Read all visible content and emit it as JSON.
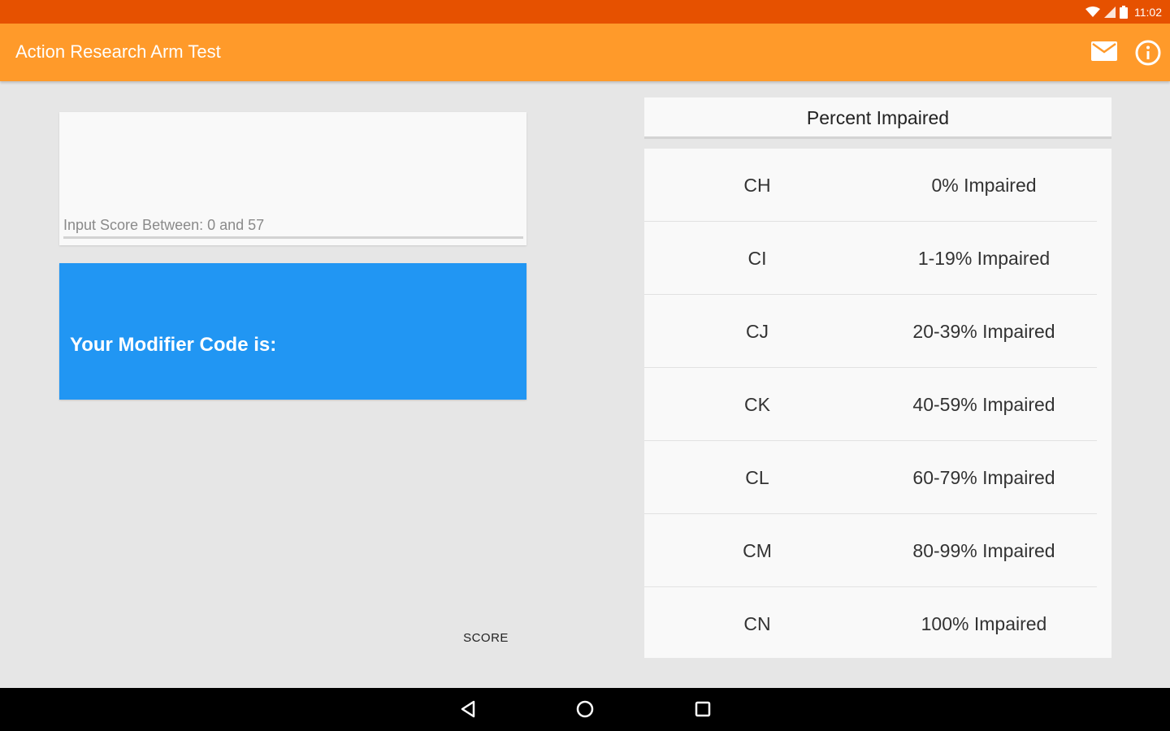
{
  "status_bar": {
    "time": "11:02",
    "icons": [
      "wifi-icon",
      "signal-icon",
      "battery-icon"
    ]
  },
  "app_bar": {
    "title": "Action Research Arm Test",
    "actions": [
      "mail-icon",
      "info-icon"
    ]
  },
  "score_input": {
    "value": "",
    "placeholder": "Input Score Between: 0 and 57"
  },
  "modifier": {
    "label": "Your Modifier Code is:"
  },
  "score_button": {
    "label": "SCORE"
  },
  "table": {
    "header": "Percent Impaired",
    "rows": [
      {
        "code": "CH",
        "percent": "0% Impaired"
      },
      {
        "code": "CI",
        "percent": "1-19% Impaired"
      },
      {
        "code": "CJ",
        "percent": "20-39% Impaired"
      },
      {
        "code": "CK",
        "percent": "40-59% Impaired"
      },
      {
        "code": "CL",
        "percent": "60-79% Impaired"
      },
      {
        "code": "CM",
        "percent": "80-99% Impaired"
      },
      {
        "code": "CN",
        "percent": "100% Impaired"
      }
    ]
  },
  "nav_bar": {
    "buttons": [
      "back-icon",
      "home-icon",
      "recents-icon"
    ]
  },
  "colors": {
    "status_bar": "#e65100",
    "app_bar": "#ff9a2a",
    "modifier_box": "#2196f3",
    "background": "#e6e6e6",
    "card": "#f9f9f9"
  }
}
